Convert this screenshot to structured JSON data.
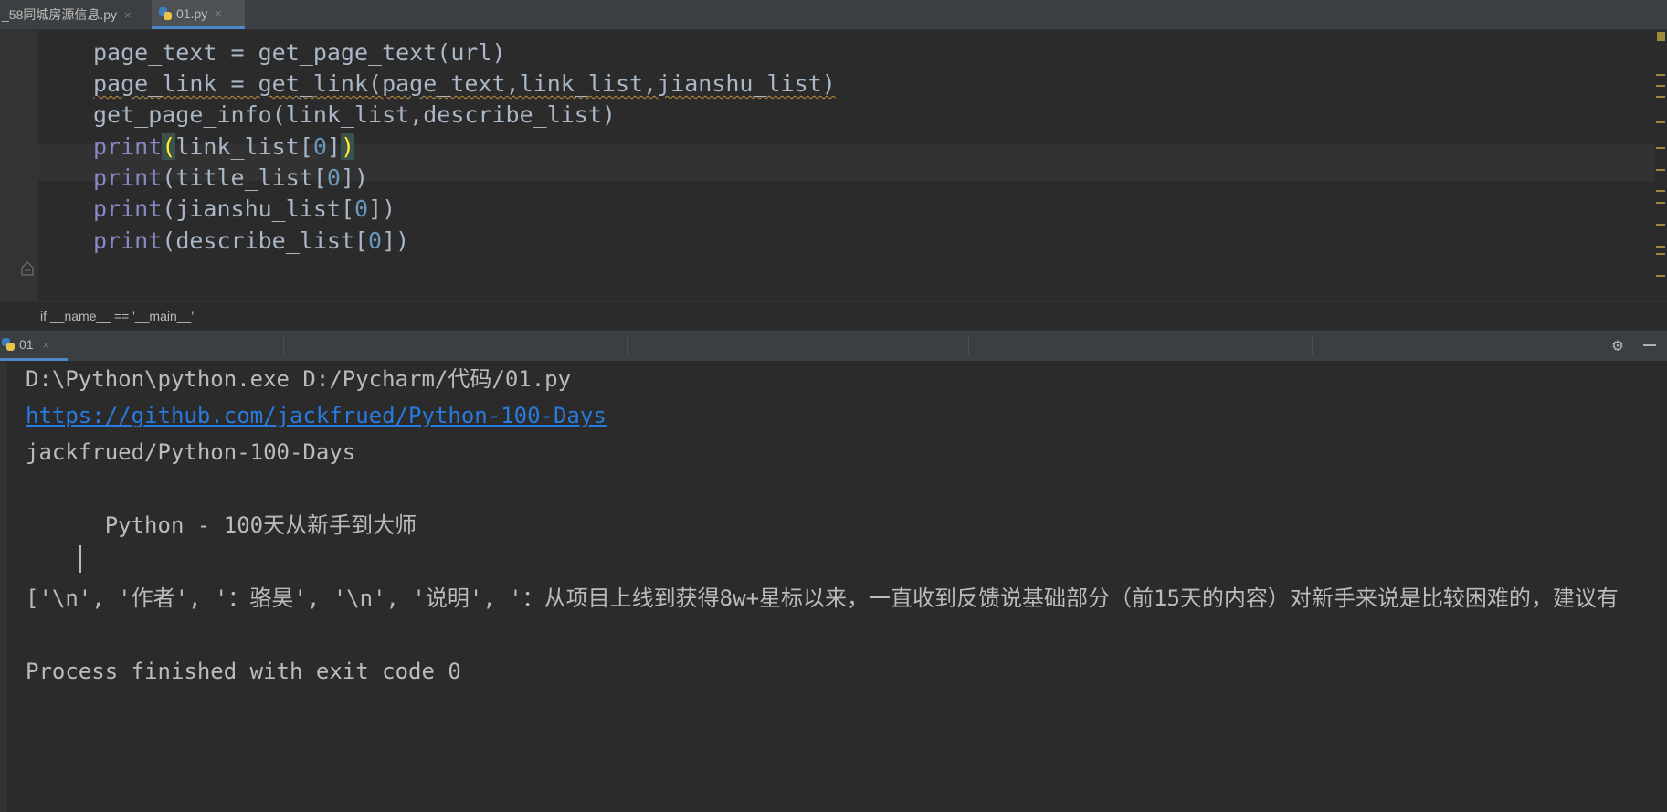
{
  "tabs": [
    {
      "label": "_58同城房源信息.py",
      "close": "×"
    },
    {
      "label": "01.py",
      "close": "×"
    }
  ],
  "editor": {
    "lines": [
      {
        "parts": [
          "page_text = get_page_text(url)"
        ]
      },
      {
        "text": "page_link = get_link(page_text,link_list,jianshu_list)"
      },
      {
        "text": "get_page_info(link_list,describe_list)"
      },
      {
        "kw": "print",
        "open": "(",
        "arg": "link_list[",
        "num": "0",
        "close": "]",
        "endparen": ")"
      },
      {
        "kw": "print",
        "open": "(",
        "arg": "title_list[",
        "num": "0",
        "close": "])"
      },
      {
        "kw": "print",
        "open": "(",
        "arg": "jianshu_list[",
        "num": "0",
        "close": "])"
      },
      {
        "kw": "print",
        "open": "(",
        "arg": "describe_list[",
        "num": "0",
        "close": "])"
      }
    ]
  },
  "breadcrumb": "if __name__ == '__main__'",
  "run_panel": {
    "tab_label": "01",
    "close": "×",
    "gear": "⚙"
  },
  "console": {
    "cmd": "D:\\Python\\python.exe D:/Pycharm/代码/01.py",
    "url": "https://github.com/jackfrued/Python-100-Days",
    "repo": "jackfrued/Python-100-Days",
    "title": "      Python - 100天从新手到大师",
    "list": "['\\n', '作者', '：骆昊', '\\n', '说明', '：从项目上线到获得8w+星标以来，一直收到反馈说基础部分（前15天的内容）对新手来说是比较困难的，建议有",
    "exit": "Process finished with exit code 0"
  },
  "colors": {
    "background": "#2b2b2b",
    "keyword": "#8888c6",
    "number": "#6897bb",
    "link": "#287bde",
    "accent": "#4a88c7"
  }
}
